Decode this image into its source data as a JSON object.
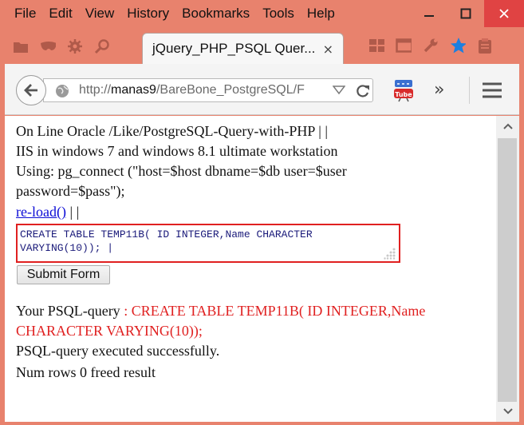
{
  "menubar": {
    "items": [
      "File",
      "Edit",
      "View",
      "History",
      "Bookmarks",
      "Tools",
      "Help"
    ]
  },
  "tab": {
    "title": "jQuery_PHP_PSQL Quer...",
    "close": "×"
  },
  "navbar": {
    "url_prefix": "http://",
    "url_host": "manas9",
    "url_path": "/BareBone_PostgreSQL/F",
    "overflow": "»"
  },
  "page": {
    "line1": "On Line Oracle /Like/PostgreSQL-Query-with-PHP | |",
    "line2": "IIS in windows 7 and windows 8.1 ultimate workstation",
    "line3": "Using: pg_connect (\"host=$host dbname=$db user=$user",
    "line4": "password=$pass\");",
    "reload_link": "re-load()",
    "reload_suffix": " | |",
    "sql_value": "CREATE TABLE TEMP11B( ID INTEGER,Name CHARACTER VARYING(10)); |",
    "submit_label": "Submit Form",
    "query_label": "Your PSQL-query ",
    "query_value_1": ": CREATE TABLE TEMP11B( ID INTEGER,Name",
    "query_value_2": "CHARACTER VARYING(10));",
    "status_1": "PSQL-query executed successfully.",
    "status_2": "Num rows 0 freed result"
  },
  "colors": {
    "frame": "#e8826d",
    "close_button": "#e04343",
    "link": "#0b0bd6",
    "query_text": "#e02020",
    "highlight_border": "#e02020",
    "star": "#1c7fe0"
  },
  "icons": [
    "minimize-icon",
    "maximize-icon",
    "close-icon",
    "folder-icon",
    "mask-icon",
    "gear-icon",
    "search-icon",
    "back-arrow-icon",
    "globe-icon",
    "dropdown-icon",
    "reload-icon",
    "youtube-icon",
    "hamburger-menu-icon",
    "scroll-up-icon",
    "scroll-down-icon"
  ]
}
